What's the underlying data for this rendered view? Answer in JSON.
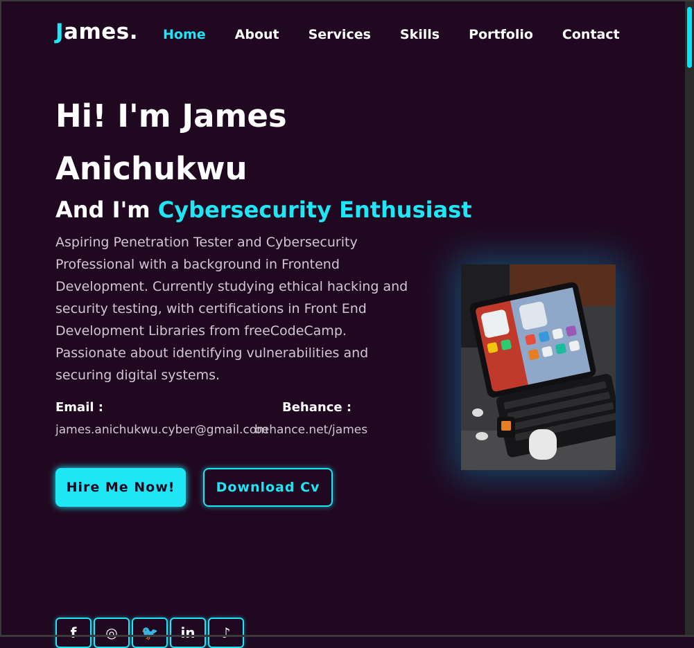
{
  "brand": {
    "logo_first": "J",
    "logo_rest": "ames.",
    "accent": "#1ee6f5",
    "background": "#200820"
  },
  "nav": {
    "items": [
      {
        "label": "Home",
        "active": true
      },
      {
        "label": "About"
      },
      {
        "label": "Services"
      },
      {
        "label": "Skills"
      },
      {
        "label": "Portfolio"
      },
      {
        "label": "Contact"
      }
    ]
  },
  "hero": {
    "title": "Hi! I'm James Anichukwu",
    "subtitle_prefix": "And I'm ",
    "subtitle_role": "Cybersecurity Enthusiast",
    "description": "Aspiring Penetration Tester and Cybersecurity Professional with a background in Frontend Development. Currently studying ethical hacking and security testing, with certifications in Front End Development Libraries from freeCodeCamp. Passionate about identifying vulnerabilities and securing digital systems.",
    "email_label": "Email :",
    "email_value": "james.anichukwu.cyber@gmail.com",
    "behance_label": "Behance :",
    "behance_value": "behance.net/james",
    "hire_button": "Hire Me Now!",
    "cv_button": "Download Cv",
    "image_icon": "tablet-keyboard-photo"
  },
  "socials": [
    {
      "icon": "facebook-icon",
      "glyph": "f"
    },
    {
      "icon": "instagram-icon",
      "glyph": "◎"
    },
    {
      "icon": "twitter-icon",
      "glyph": "🐦"
    },
    {
      "icon": "linkedin-icon",
      "glyph": "in"
    },
    {
      "icon": "tiktok-icon",
      "glyph": "♪"
    }
  ]
}
